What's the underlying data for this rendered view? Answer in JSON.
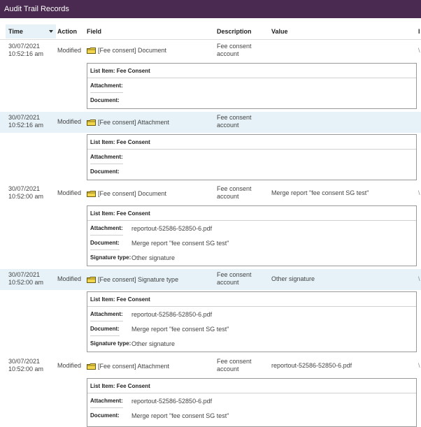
{
  "window": {
    "title": "Audit Trail Records"
  },
  "columns": {
    "time": "Time",
    "action": "Action",
    "field": "Field",
    "description": "Description",
    "value": "Value",
    "extra": "I"
  },
  "records": [
    {
      "date": "30/07/2021",
      "clock": "10:52:16 am",
      "action": "Modified",
      "field": "[Fee consent] Document",
      "description_1": "Fee consent",
      "description_2": "account",
      "value": "",
      "edge": "\\",
      "detail": {
        "list_item_label": "List Item: Fee Consent",
        "attachment_label": "Attachment:",
        "attachment_value": "",
        "document_label": "Document:",
        "document_value": ""
      }
    },
    {
      "date": "30/07/2021",
      "clock": "10:52:16 am",
      "action": "Modified",
      "field": "[Fee consent] Attachment",
      "description_1": "Fee consent",
      "description_2": "account",
      "value": "",
      "edge": "",
      "detail": {
        "list_item_label": "List Item: Fee Consent",
        "attachment_label": "Attachment:",
        "attachment_value": "",
        "document_label": "Document:",
        "document_value": ""
      }
    },
    {
      "date": "30/07/2021",
      "clock": "10:52:00 am",
      "action": "Modified",
      "field": "[Fee consent] Document",
      "description_1": "Fee consent",
      "description_2": "account",
      "value": "Merge report \"fee consent SG test\"",
      "edge": "\\",
      "detail": {
        "list_item_label": "List Item: Fee Consent",
        "attachment_label": "Attachment:",
        "attachment_value": "reportout-52586-52850-6.pdf",
        "document_label": "Document:",
        "document_value": "Merge report \"fee consent SG test\"",
        "signature_label": "Signature type:",
        "signature_value": "Other signature"
      }
    },
    {
      "date": "30/07/2021",
      "clock": "10:52:00 am",
      "action": "Modified",
      "field": "[Fee consent] Signature type",
      "description_1": "Fee consent",
      "description_2": "account",
      "value": "Other signature",
      "edge": "\\",
      "detail": {
        "list_item_label": "List Item: Fee Consent",
        "attachment_label": "Attachment:",
        "attachment_value": "reportout-52586-52850-6.pdf",
        "document_label": "Document:",
        "document_value": "Merge report \"fee consent SG test\"",
        "signature_label": "Signature type:",
        "signature_value": "Other signature"
      }
    },
    {
      "date": "30/07/2021",
      "clock": "10:52:00 am",
      "action": "Modified",
      "field": "[Fee consent] Attachment",
      "description_1": "Fee consent",
      "description_2": "account",
      "value": "reportout-52586-52850-6.pdf",
      "edge": "\\",
      "detail": {
        "list_item_label": "List Item: Fee Consent",
        "attachment_label": "Attachment:",
        "attachment_value": "reportout-52586-52850-6.pdf",
        "document_label": "Document:",
        "document_value": "Merge report \"fee consent SG test\""
      }
    }
  ],
  "colors": {
    "titlebar": "#4a2a50",
    "row_highlight": "#e6f2f8",
    "folder": "#f2d64b"
  },
  "icons": {
    "sort": "sort-desc-icon",
    "folder": "folder-icon"
  }
}
